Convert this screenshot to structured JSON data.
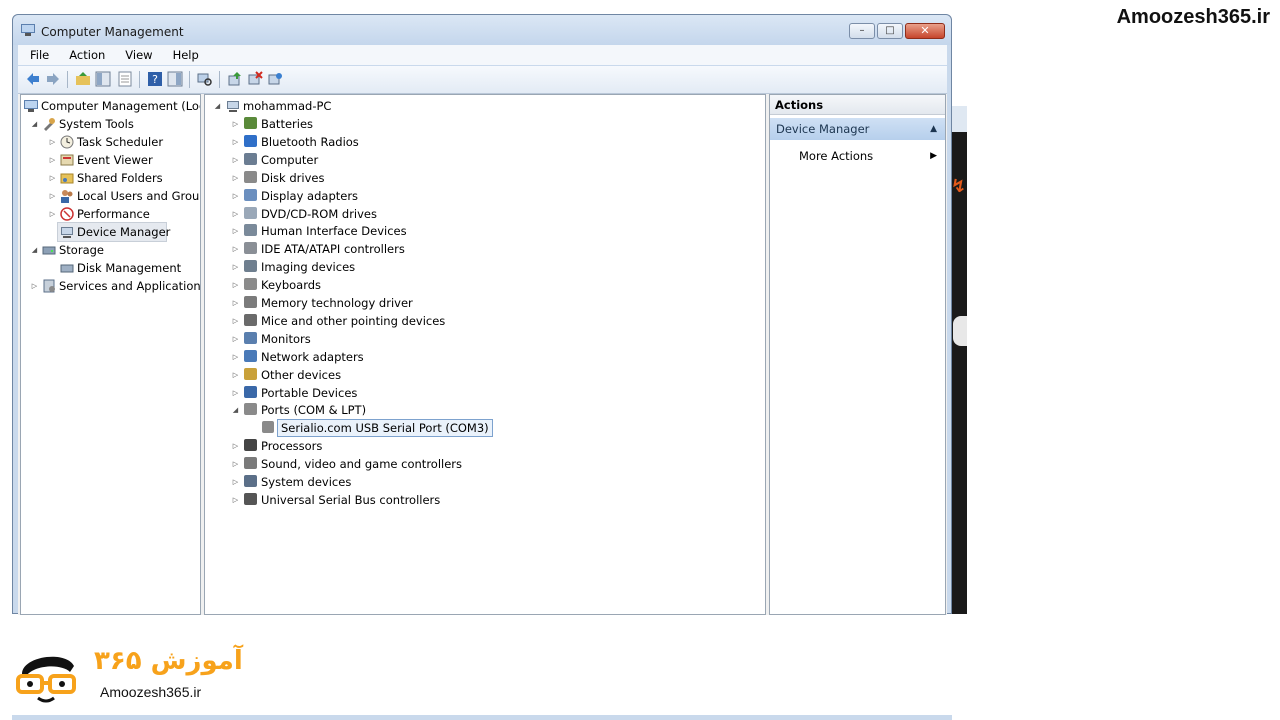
{
  "watermark": "Amoozesh365.ir",
  "window": {
    "title": "Computer Management",
    "buttons": {
      "minimize": "–",
      "maximize": "□",
      "close": "✕"
    }
  },
  "menu": [
    "File",
    "Action",
    "View",
    "Help"
  ],
  "left_tree": {
    "root": "Computer Management (Local",
    "system_tools": "System Tools",
    "task_scheduler": "Task Scheduler",
    "event_viewer": "Event Viewer",
    "shared_folders": "Shared Folders",
    "local_users": "Local Users and Groups",
    "performance": "Performance",
    "device_manager": "Device Manager",
    "storage": "Storage",
    "disk_management": "Disk Management",
    "services": "Services and Applications"
  },
  "device_tree": {
    "computer": "mohammad-PC",
    "categories": [
      "Batteries",
      "Bluetooth Radios",
      "Computer",
      "Disk drives",
      "Display adapters",
      "DVD/CD-ROM drives",
      "Human Interface Devices",
      "IDE ATA/ATAPI controllers",
      "Imaging devices",
      "Keyboards",
      "Memory technology driver",
      "Mice and other pointing devices",
      "Monitors",
      "Network adapters",
      "Other devices",
      "Portable Devices",
      "Ports (COM & LPT)",
      "Processors",
      "Sound, video and game controllers",
      "System devices",
      "Universal Serial Bus controllers"
    ],
    "port_child": "Serialio.com USB Serial Port (COM3)"
  },
  "actions": {
    "header": "Actions",
    "section": "Device Manager",
    "more": "More Actions"
  },
  "logo": {
    "brand_fa": "آموزش ۳۶۵",
    "brand_en": "Amoozesh365.ir"
  },
  "colors": {
    "titlebar": "#c9d9ec",
    "accent_orange": "#f7a21b",
    "selection": "#eaf2fb"
  }
}
